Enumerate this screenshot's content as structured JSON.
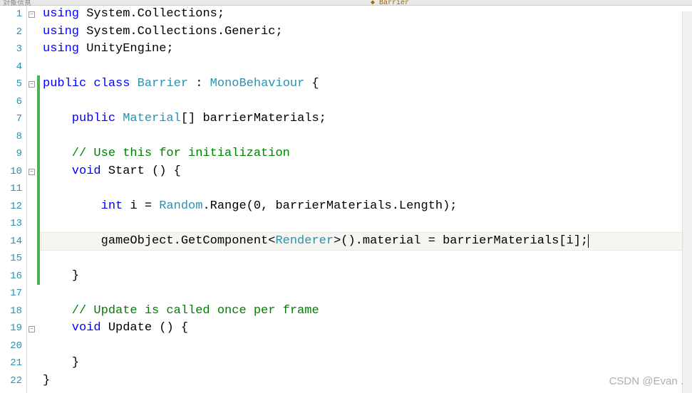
{
  "top": {
    "left_crumb": "对象信息",
    "tab_label": "◆ Barrier"
  },
  "lines": {
    "n1": "1",
    "n2": "2",
    "n3": "3",
    "n4": "4",
    "n5": "5",
    "n6": "6",
    "n7": "7",
    "n8": "8",
    "n9": "9",
    "n10": "10",
    "n11": "11",
    "n12": "12",
    "n13": "13",
    "n14": "14",
    "n15": "15",
    "n16": "16",
    "n17": "17",
    "n18": "18",
    "n19": "19",
    "n20": "20",
    "n21": "21",
    "n22": "22"
  },
  "code": {
    "l1": {
      "kw": "using",
      "ns": " System.Collections;"
    },
    "l2": {
      "kw": "using",
      "ns": " System.Collections.Generic;"
    },
    "l3": {
      "kw": "using",
      "ns": " UnityEngine;"
    },
    "l5a": "public",
    "l5b": " class ",
    "l5c": "Barrier",
    "l5d": " : ",
    "l5e": "MonoBehaviour",
    "l5f": " {",
    "l7a": "    public ",
    "l7b": "Material",
    "l7c": "[] barrierMaterials;",
    "l9": "    // Use this for initialization",
    "l10a": "    void",
    "l10b": " Start",
    "l10c": " () {",
    "l12a": "        int",
    "l12b": " i = ",
    "l12c": "Random",
    "l12d": ".Range(0, barrierMaterials.Length);",
    "l14a": "        gameObject.GetComponent<",
    "l14b": "Renderer",
    "l14c": ">().material = barrierMaterials[i];",
    "l16": "    }",
    "l18": "    // Update is called once per frame",
    "l19a": "    void",
    "l19b": " Update",
    "l19c": " () {",
    "l21": "    }",
    "l22": "}"
  },
  "fold": {
    "minus": "−",
    "plus": "+"
  },
  "watermark": "CSDN @Evan ."
}
